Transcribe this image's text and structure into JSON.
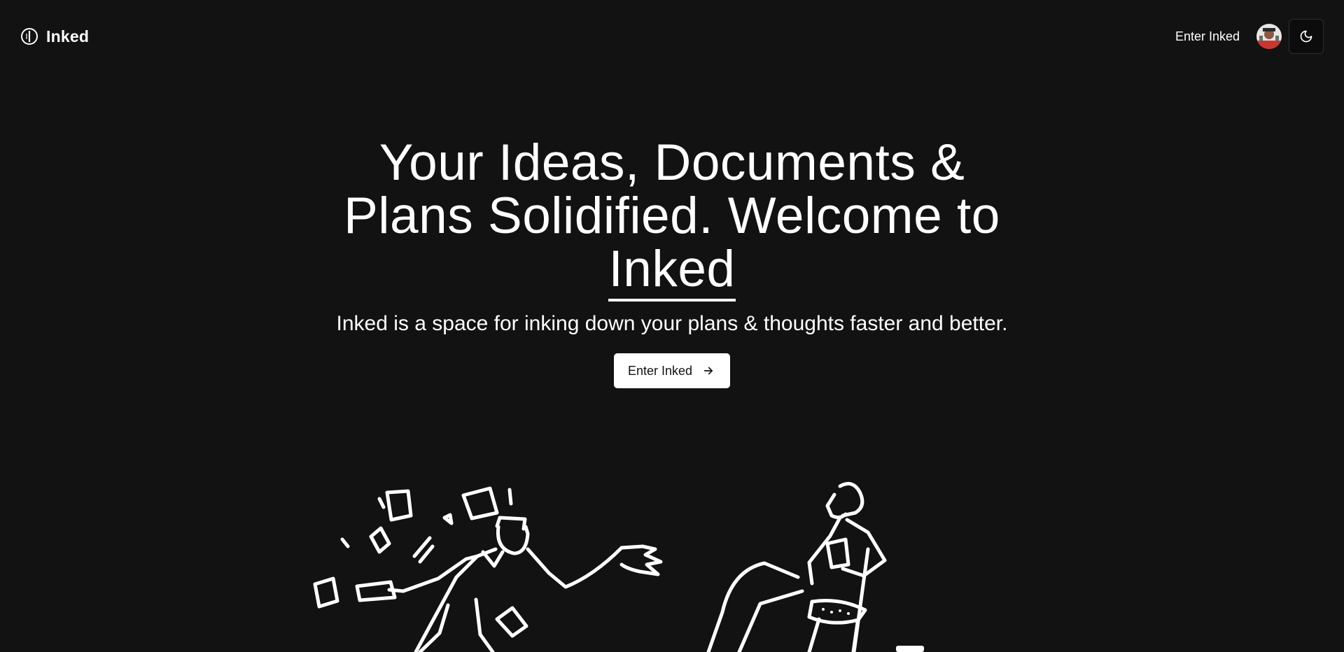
{
  "navbar": {
    "brand_name": "Inked",
    "enter_link": "Enter Inked",
    "logo_icon": "document-logo-icon",
    "theme_icon": "moon-icon"
  },
  "hero": {
    "title_line": "Your Ideas, Documents & Plans Solidified. Welcome to",
    "title_highlight": "Inked",
    "subtitle": "Inked is a space for inking down your plans & thoughts faster and better.",
    "cta_label": "Enter Inked",
    "cta_icon": "arrow-right-icon"
  },
  "colors": {
    "background": "#121212",
    "text": "#ffffff",
    "button_bg": "#ffffff",
    "button_text": "#111111"
  }
}
